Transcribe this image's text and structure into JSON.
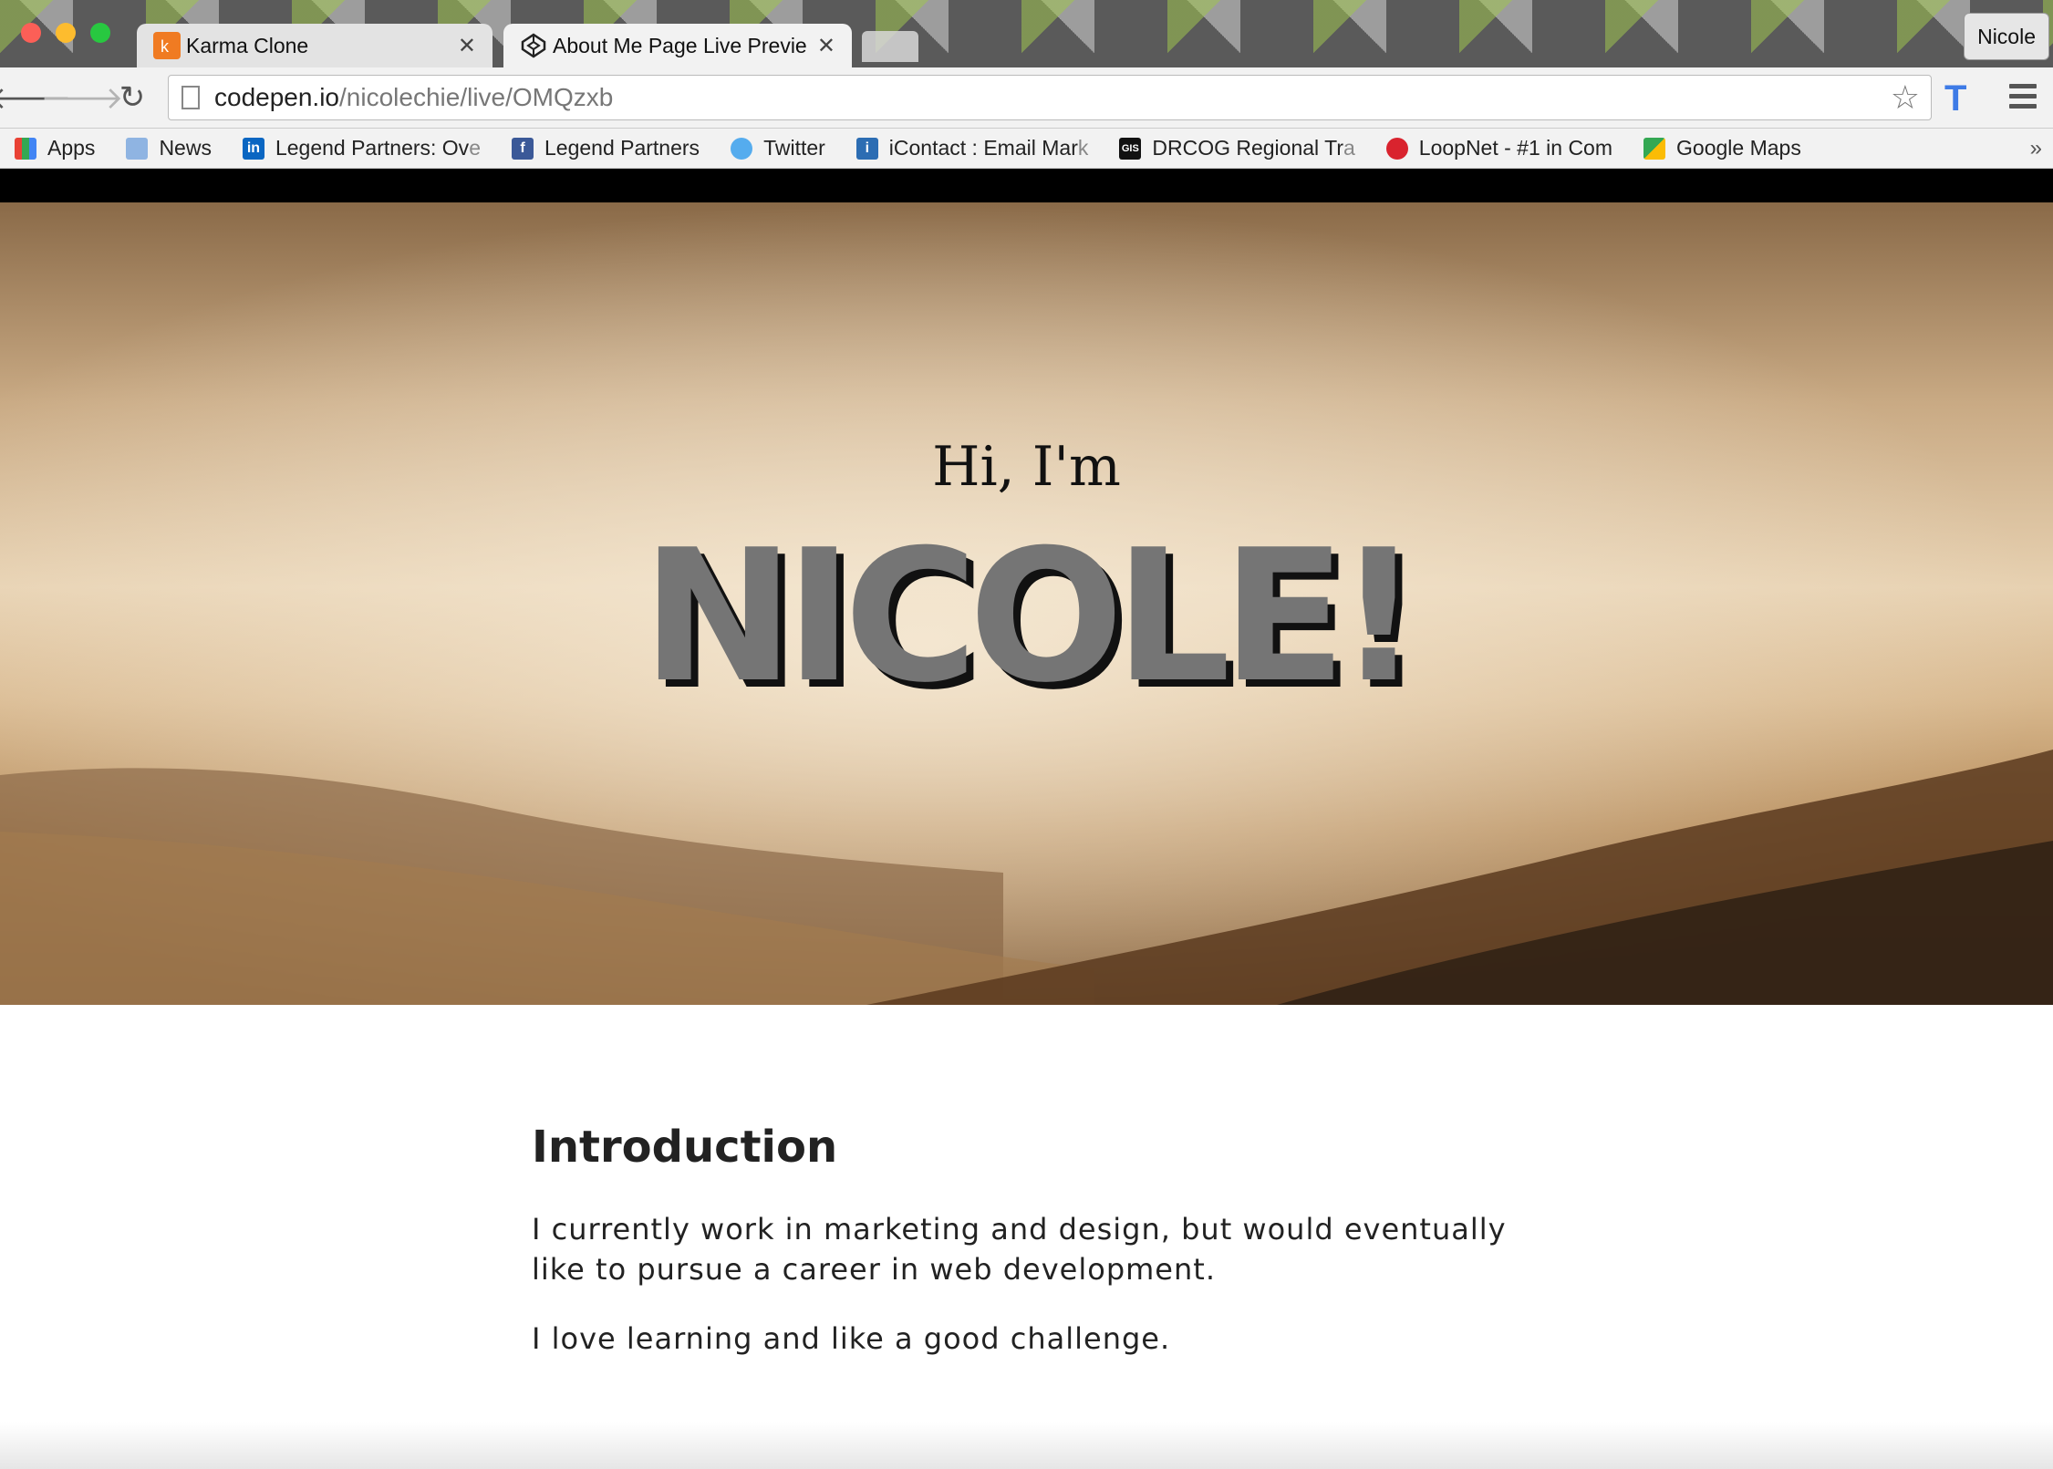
{
  "browser": {
    "tabs": [
      {
        "title": "Karma Clone",
        "active": false,
        "icon": "karma-icon"
      },
      {
        "title": "About Me Page Live Previe",
        "active": true,
        "icon": "codepen-icon"
      }
    ],
    "tab_close": "✕",
    "profile_name": "Nicole",
    "url_host": "codepen.io",
    "url_path": "/nicolechie/live/OMQzxb",
    "bookmarks": [
      {
        "label": "Apps",
        "icon": "apps-grid-icon"
      },
      {
        "label": "News",
        "icon": "folder-icon"
      },
      {
        "label": "Legend Partners: Ov",
        "fade": "e",
        "icon": "linkedin-icon"
      },
      {
        "label": "Legend Partners",
        "icon": "facebook-icon"
      },
      {
        "label": "Twitter",
        "icon": "twitter-icon"
      },
      {
        "label": "iContact : Email Mar",
        "fade": "k",
        "icon": "icontact-icon"
      },
      {
        "label": "DRCOG Regional Tr",
        "fade": "a",
        "icon": "gis-icon"
      },
      {
        "label": "LoopNet - #1 in Com",
        "fade": "",
        "icon": "loopnet-icon"
      },
      {
        "label": "Google Maps",
        "icon": "google-maps-icon"
      }
    ],
    "bookmarks_overflow": "»"
  },
  "page": {
    "greeting": "Hi, I'm",
    "name": "NICOLE!",
    "intro_heading": "Introduction",
    "intro_paragraphs": [
      "I currently work in marketing and design, but would eventually like to pursue a career in web development.",
      "I love learning and like a good challenge."
    ]
  },
  "colors": {
    "hero_name": "#757575",
    "link_blue": "#3e7be6"
  }
}
